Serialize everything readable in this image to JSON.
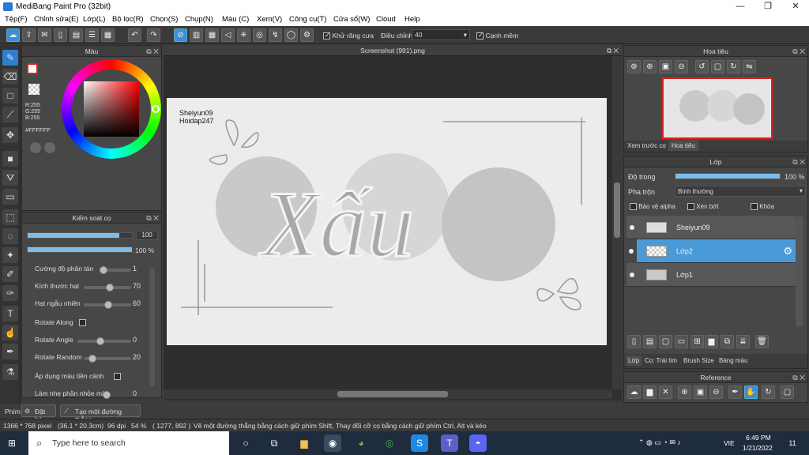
{
  "window": {
    "title": "MediBang Paint Pro (32bit)",
    "minimize": "—",
    "maximize": "❐",
    "close": "✕"
  },
  "menu": [
    "Tệp(F)",
    "Chỉnh sửa(E)",
    "Lớp(L)",
    "Bộ lọc(R)",
    "Chọn(S)",
    "Chụp(N)",
    "Màu (C)",
    "Xem(V)",
    "Công cụ(T)",
    "Cửa sổ(W)",
    "Cloud",
    "Help"
  ],
  "toolbar": {
    "antialias_label": "Khử răng cưa",
    "adjust_label": "Điều chỉnh",
    "adjust_value": "40",
    "edge_label": "Cạnh mềm"
  },
  "color_panel": {
    "title": "Màu",
    "r": "R:255",
    "g": "G:255",
    "b": "B:255",
    "hex": "#FFFFFF",
    "accent": "#e02020"
  },
  "brush_panel": {
    "title": "Kiểm soát cọ",
    "size_value": "100",
    "opacity_value": "100 %",
    "rows": [
      {
        "label": "Cường độ phân tán",
        "value": "1"
      },
      {
        "label": "Kích thước hạt",
        "value": "70"
      },
      {
        "label": "Hạt ngẫu nhiên",
        "value": "60"
      },
      {
        "label": "Rotate Along",
        "value": ""
      },
      {
        "label": "Rotate Angle",
        "value": "0"
      },
      {
        "label": "Rotate Random",
        "value": "20"
      },
      {
        "label": "Áp dụng màu tiền cảnh",
        "value": ""
      },
      {
        "label": "Làm nhẹ phần nhỏe màu",
        "value": "0"
      }
    ]
  },
  "document": {
    "tab": "Screenshot (991).png",
    "caption1": "Sheiyun09",
    "caption2": "Hoidap247",
    "word": "Xấu"
  },
  "navigator": {
    "title": "Hoa tiêu",
    "tab_preview": "Xem trước cọ",
    "tab_nav": "Hoa tiêu"
  },
  "layers_panel": {
    "title": "Lớp",
    "opacity_label": "Độ trong",
    "opacity_value": "100 %",
    "blend_label": "Pha trộn",
    "blend_value": "Bình thường",
    "protect_alpha": "Bảo vệ alpha",
    "clip": "Xén bớt",
    "lock": "Khóa",
    "layers": [
      {
        "name": "Sheiyun09"
      },
      {
        "name": "Lớp2"
      },
      {
        "name": "Lớp1"
      }
    ],
    "tabs": [
      "Lớp",
      "Cọ: Trái tim",
      "Brush Size",
      "Bảng màu"
    ]
  },
  "reference": {
    "title": "Reference"
  },
  "bottom": {
    "tab": "Phím",
    "reset": "Đặt lại",
    "straight": "Tạo một đường thẳng"
  },
  "status": {
    "size": "1366 * 768 pixel",
    "cm": "(36.1 * 20.3cm)",
    "dpi": "96 dpi",
    "zoom": "54 %",
    "coords": "( 1277, 892 )",
    "hint": "Vẽ một đường thẳng bằng cách giữ phím Shift, Thay đổi cỡ cọ bằng cách giữ phím Ctrl, Alt và kéo"
  },
  "taskbar": {
    "search_placeholder": "Type here to search",
    "time": "6:49 PM",
    "date": "1/21/2022",
    "lang": "VIE",
    "notif": "11"
  }
}
